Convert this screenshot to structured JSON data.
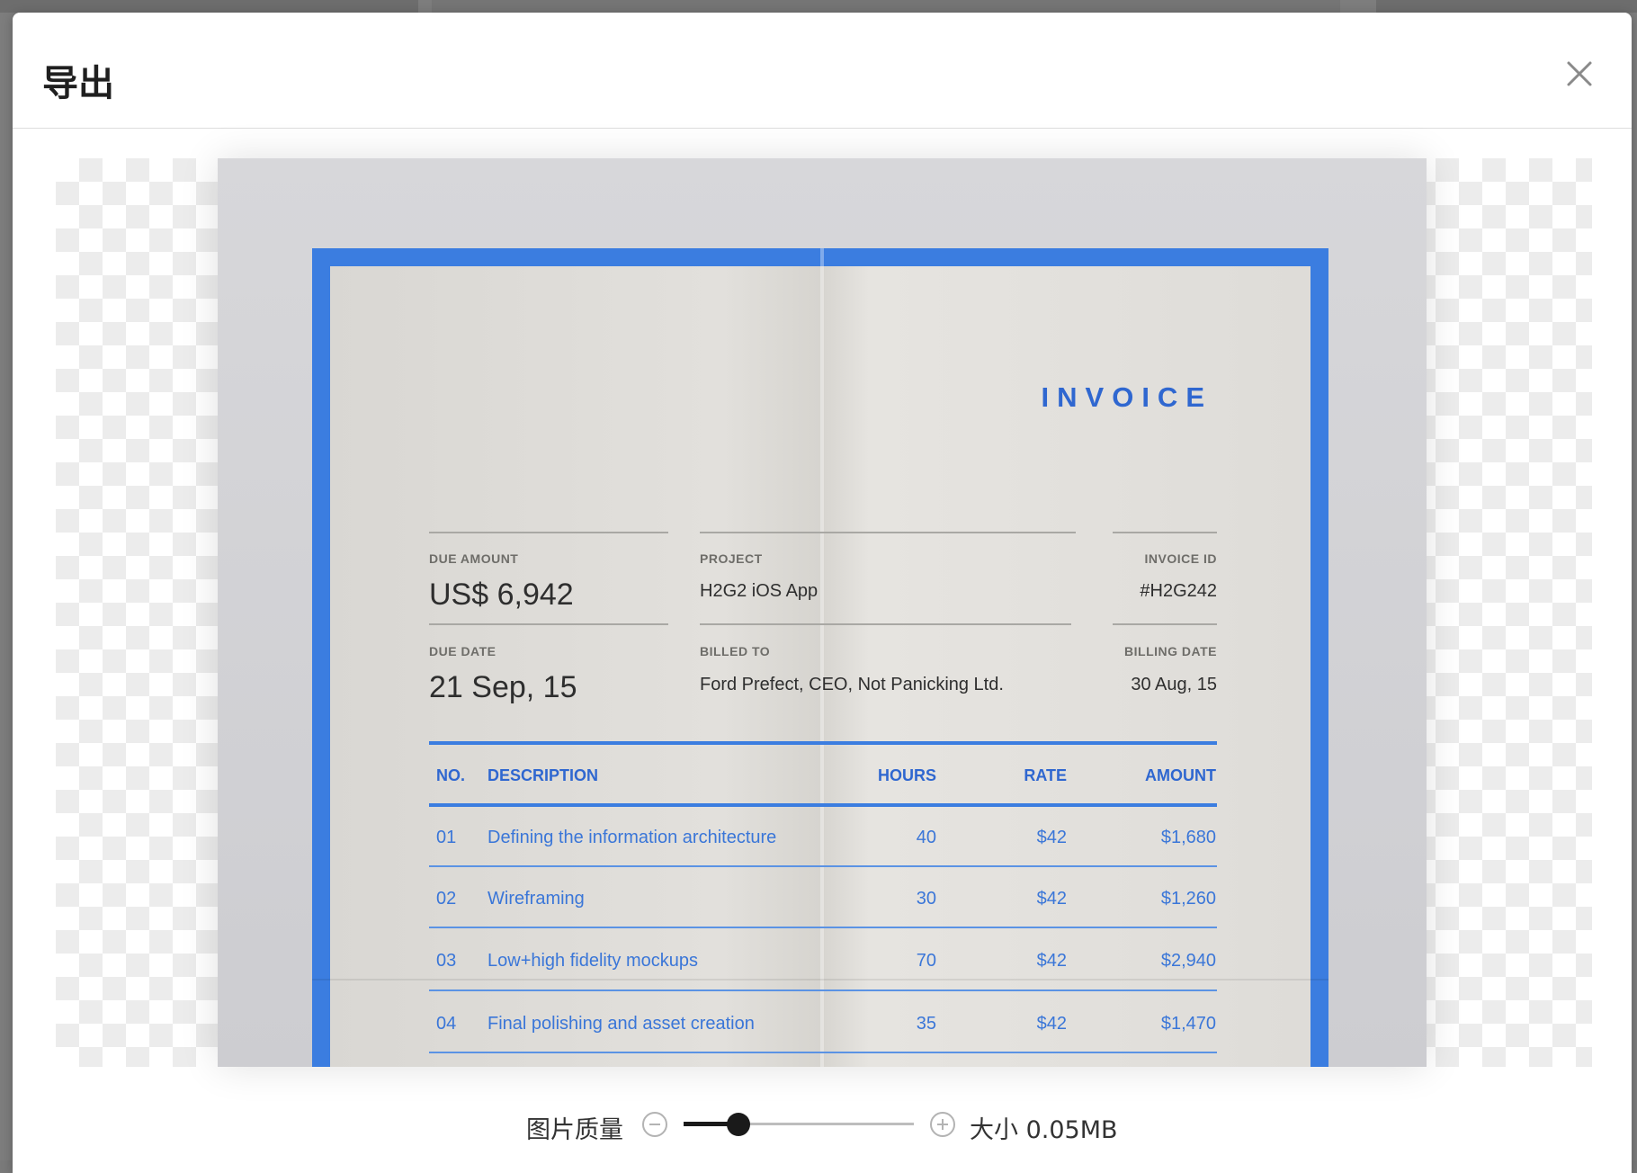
{
  "dialog": {
    "title": "导出"
  },
  "invoice": {
    "title": "INVOICE",
    "fields": {
      "due_amount_label": "DUE AMOUNT",
      "due_amount": "US$ 6,942",
      "project_label": "PROJECT",
      "project": "H2G2 iOS App",
      "invoice_id_label": "INVOICE ID",
      "invoice_id": "#H2G242",
      "due_date_label": "DUE DATE",
      "due_date": "21 Sep, 15",
      "billed_to_label": "BILLED TO",
      "billed_to": "Ford Prefect, CEO, Not Panicking Ltd.",
      "billing_date_label": "BILLING DATE",
      "billing_date": "30 Aug, 15"
    },
    "columns": {
      "no": "NO.",
      "description": "DESCRIPTION",
      "hours": "HOURS",
      "rate": "RATE",
      "amount": "AMOUNT"
    },
    "rows": [
      {
        "no": "01",
        "description": "Defining the information architecture",
        "hours": "40",
        "rate": "$42",
        "amount": "$1,680"
      },
      {
        "no": "02",
        "description": "Wireframing",
        "hours": "30",
        "rate": "$42",
        "amount": "$1,260"
      },
      {
        "no": "03",
        "description": "Low+high fidelity mockups",
        "hours": "70",
        "rate": "$42",
        "amount": "$2,940"
      },
      {
        "no": "04",
        "description": "Final polishing and asset creation",
        "hours": "35",
        "rate": "$42",
        "amount": "$1,470"
      }
    ]
  },
  "quality": {
    "label": "图片质量",
    "value_fraction": 0.24,
    "size_text": "大小 0.05MB"
  },
  "icons": {
    "close": "close-icon",
    "minus": "minus-circle-icon",
    "plus": "plus-circle-icon"
  },
  "colors": {
    "accent": "#3b7de0",
    "slider": "#1a1a1a"
  }
}
